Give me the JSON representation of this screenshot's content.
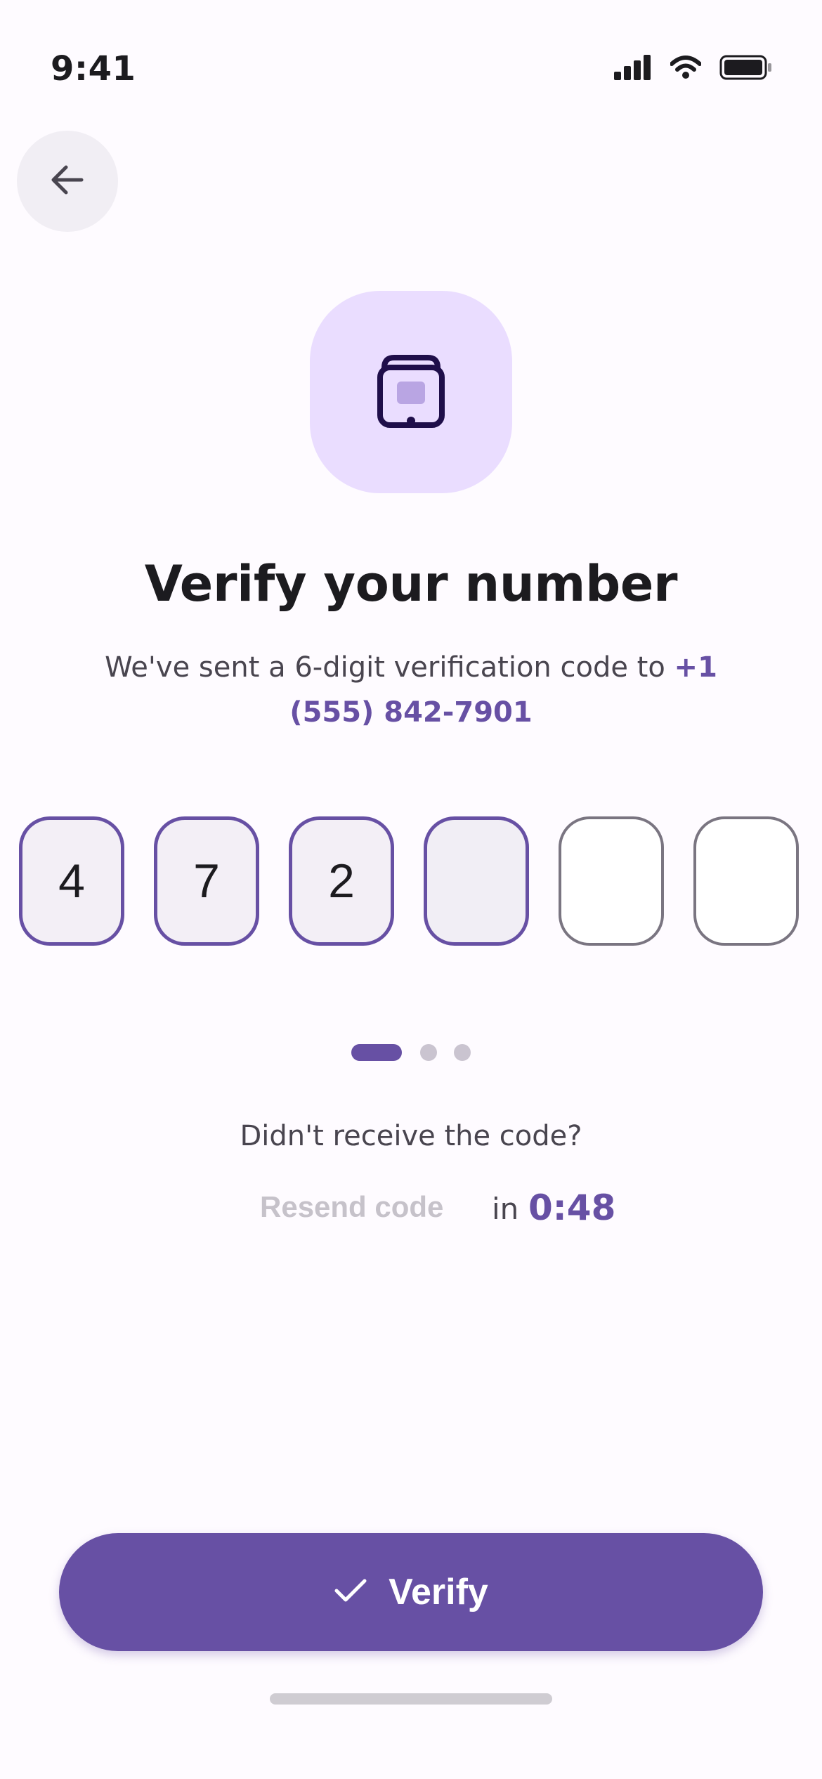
{
  "status_bar": {
    "time": "9:41",
    "icons": [
      "signal-icon",
      "wifi-icon",
      "battery-icon"
    ]
  },
  "nav": {
    "back_icon": "arrow-left-icon"
  },
  "hero": {
    "icon": "phone-lock-icon"
  },
  "content": {
    "title": "Verify your number",
    "subtitle_prefix": "We've sent a 6-digit verification code to ",
    "phone_number": "+1 (555) 842-7901"
  },
  "otp": {
    "digits": [
      "4",
      "7",
      "2",
      "",
      "",
      ""
    ],
    "active_index": 3
  },
  "pager": {
    "total": 3,
    "active": 0
  },
  "resend": {
    "prompt": "Didn't receive the code?",
    "link_label": "Resend code",
    "in_label": "in",
    "timer": "0:48"
  },
  "verify": {
    "label": "Verify",
    "icon": "check-icon"
  },
  "colors": {
    "primary": "#6750a4",
    "primary_container": "#eaddff",
    "background": "#fefbff",
    "on_surface_variant": "#49454f",
    "outline": "#7a7581",
    "disabled_text": "#c6c2ca"
  }
}
